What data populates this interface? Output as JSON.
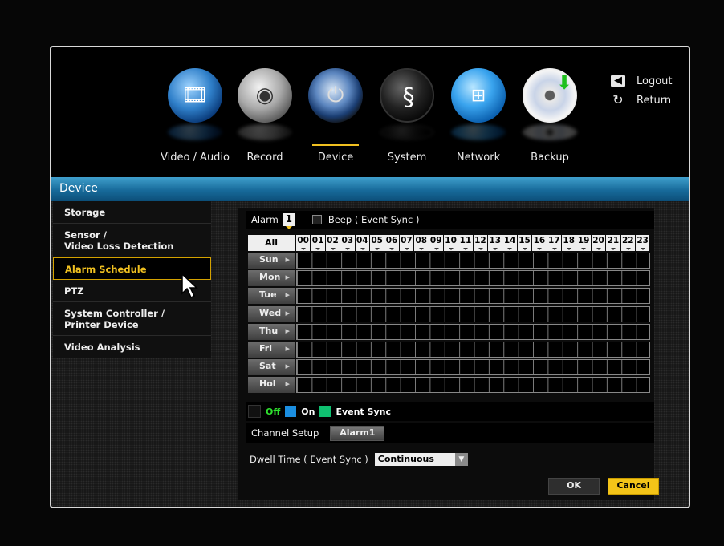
{
  "top_menu": {
    "items": [
      {
        "label": "Video / Audio",
        "icon": "video-audio-icon"
      },
      {
        "label": "Record",
        "icon": "record-camera-icon"
      },
      {
        "label": "Device",
        "icon": "device-icon",
        "active": true
      },
      {
        "label": "System",
        "icon": "system-icon"
      },
      {
        "label": "Network",
        "icon": "network-icon"
      },
      {
        "label": "Backup",
        "icon": "backup-disc-icon"
      }
    ],
    "logout": "Logout",
    "return": "Return"
  },
  "section_title": "Device",
  "sidebar": {
    "items": [
      {
        "line1": "Storage",
        "line2": ""
      },
      {
        "line1": "Sensor /",
        "line2": "Video Loss Detection"
      },
      {
        "line1": "Alarm Schedule",
        "line2": "",
        "selected": true
      },
      {
        "line1": "PTZ",
        "line2": ""
      },
      {
        "line1": "System Controller /",
        "line2": "Printer Device"
      },
      {
        "line1": "Video Analysis",
        "line2": ""
      }
    ]
  },
  "alarm": {
    "label": "Alarm",
    "number": "1",
    "beep_label": "Beep ( Event Sync )",
    "beep_checked": false
  },
  "schedule": {
    "all_label": "All",
    "hours": [
      "00",
      "01",
      "02",
      "03",
      "04",
      "05",
      "06",
      "07",
      "08",
      "09",
      "10",
      "11",
      "12",
      "13",
      "14",
      "15",
      "16",
      "17",
      "18",
      "19",
      "20",
      "21",
      "22",
      "23"
    ],
    "days": [
      "Sun",
      "Mon",
      "Tue",
      "Wed",
      "Thu",
      "Fri",
      "Sat",
      "Hol"
    ]
  },
  "legend": {
    "off": "Off",
    "on": "On",
    "event_sync": "Event Sync",
    "colors": {
      "off": "#111111",
      "on": "#1b8ee0",
      "event_sync": "#0fc070",
      "off_text": "#2ee02e"
    }
  },
  "channel_setup": {
    "label": "Channel Setup",
    "button": "Alarm1"
  },
  "dwell": {
    "label": "Dwell Time ( Event Sync )",
    "value": "Continuous"
  },
  "buttons": {
    "ok": "OK",
    "cancel": "Cancel"
  },
  "colors": {
    "accent": "#f0c020",
    "header_blue": "#1f7aab"
  }
}
